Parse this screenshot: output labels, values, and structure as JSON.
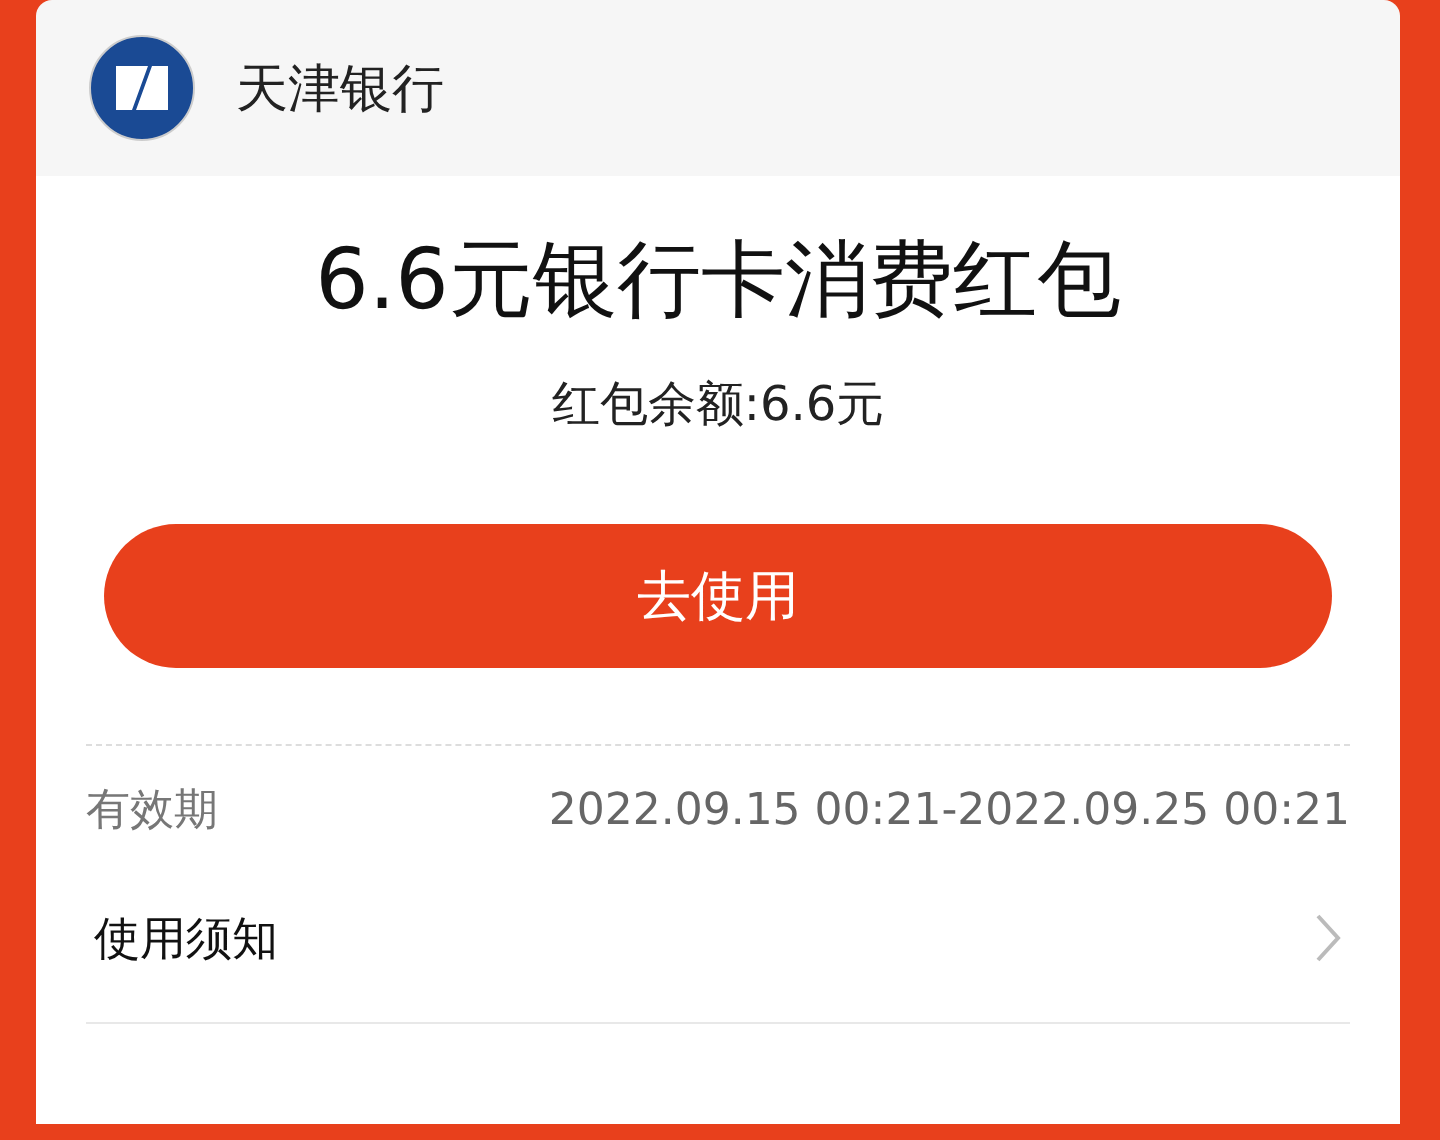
{
  "header": {
    "bank_name": "天津银行"
  },
  "coupon": {
    "title": "6.6元银行卡消费红包",
    "balance": "红包余额:6.6元"
  },
  "button": {
    "label": "去使用"
  },
  "details": [
    {
      "kind": "info",
      "label": "有效期",
      "value": "2022.09.15 00:21-2022.09.25 00:21"
    },
    {
      "kind": "link",
      "label": "使用须知"
    }
  ]
}
